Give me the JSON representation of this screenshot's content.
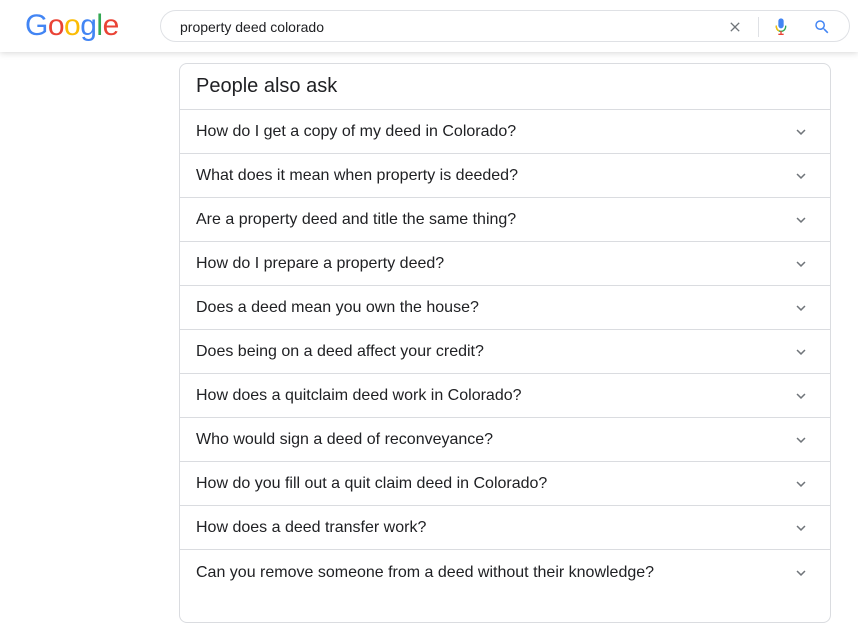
{
  "logo": {
    "letters": [
      "G",
      "o",
      "o",
      "g",
      "l",
      "e"
    ],
    "colors": [
      "#4285F4",
      "#EA4335",
      "#FBBC05",
      "#4285F4",
      "#34A853",
      "#EA4335"
    ]
  },
  "search": {
    "query": "property deed colorado",
    "clear_icon": "close-icon",
    "mic_icon": "microphone-icon",
    "search_icon": "search-icon"
  },
  "paa": {
    "title": "People also ask",
    "questions": [
      "How do I get a copy of my deed in Colorado?",
      "What does it mean when property is deeded?",
      "Are a property deed and title the same thing?",
      "How do I prepare a property deed?",
      "Does a deed mean you own the house?",
      "Does being on a deed affect your credit?",
      "How does a quitclaim deed work in Colorado?",
      "Who would sign a deed of reconveyance?",
      "How do you fill out a quit claim deed in Colorado?",
      "How does a deed transfer work?",
      "Can you remove someone from a deed without their knowledge?"
    ],
    "expand_icon": "chevron-down-icon"
  },
  "colors": {
    "text": "#202124",
    "border": "#dadce0",
    "icon_grey": "#70757a",
    "search_blue": "#4285F4"
  }
}
